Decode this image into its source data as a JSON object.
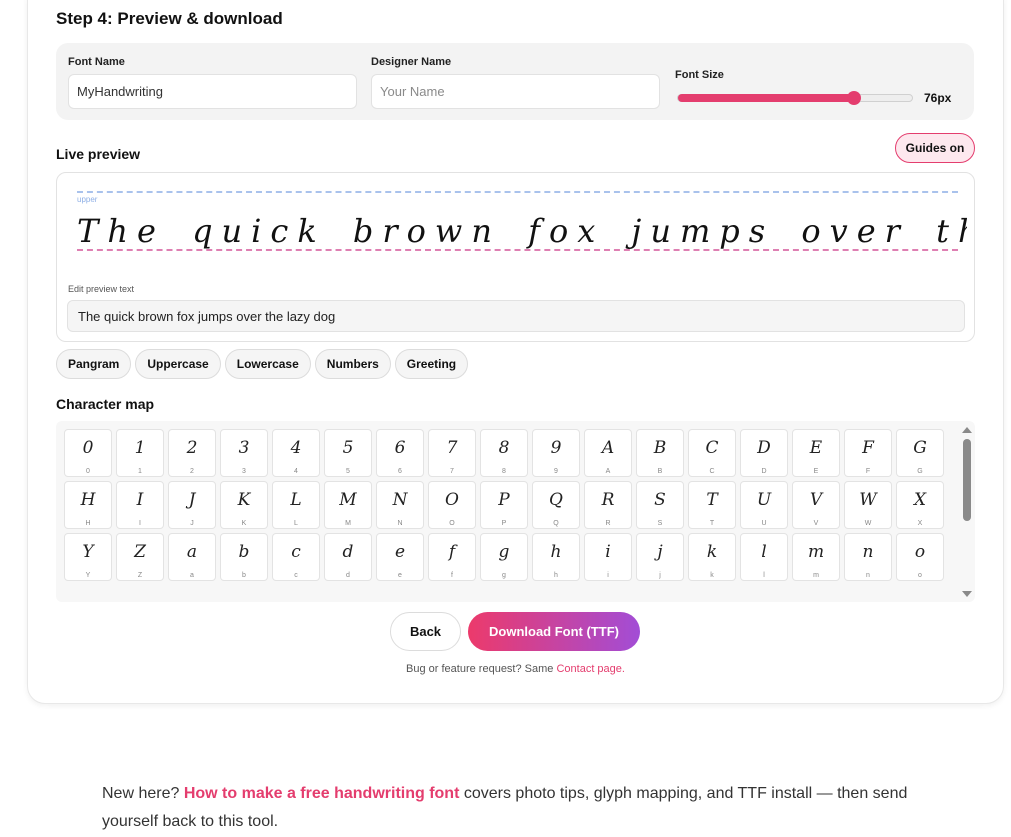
{
  "step": {
    "title": "Step 4: Preview & download"
  },
  "settings": {
    "font_name_label": "Font Name",
    "font_name_value": "MyHandwriting",
    "designer_name_label": "Designer Name",
    "designer_name_placeholder": "Your Name",
    "font_size_label": "Font Size",
    "font_size_value": "76px",
    "font_size_fraction": 0.75,
    "accent_color": "#e43d6e"
  },
  "preview": {
    "heading": "Live preview",
    "guides_button": "Guides on",
    "guide_upper_label": "upper",
    "sample_text": "The quick brown fox jumps over the lazy dog",
    "edit_label": "Edit preview text",
    "edit_value": "The quick brown fox jumps over the lazy dog"
  },
  "presets": [
    "Pangram",
    "Uppercase",
    "Lowercase",
    "Numbers",
    "Greeting"
  ],
  "charmap": {
    "heading": "Character map",
    "chars": [
      "0",
      "1",
      "2",
      "3",
      "4",
      "5",
      "6",
      "7",
      "8",
      "9",
      "A",
      "B",
      "C",
      "D",
      "E",
      "F",
      "G",
      "H",
      "I",
      "J",
      "K",
      "L",
      "M",
      "N",
      "O",
      "P",
      "Q",
      "R",
      "S",
      "T",
      "U",
      "V",
      "W",
      "X",
      "Y",
      "Z",
      "a",
      "b",
      "c",
      "d",
      "e",
      "f",
      "g",
      "h",
      "i",
      "j",
      "k",
      "l",
      "m",
      "n",
      "o"
    ]
  },
  "actions": {
    "back": "Back",
    "download": "Download Font (TTF)",
    "bug_text": "Bug or feature request? Same",
    "contact_link": "Contact page."
  },
  "footer": {
    "prefix": "New here?",
    "link": "How to make a free handwriting font",
    "suffix": "covers photo tips, glyph mapping, and TTF install — then send yourself back to this tool."
  }
}
